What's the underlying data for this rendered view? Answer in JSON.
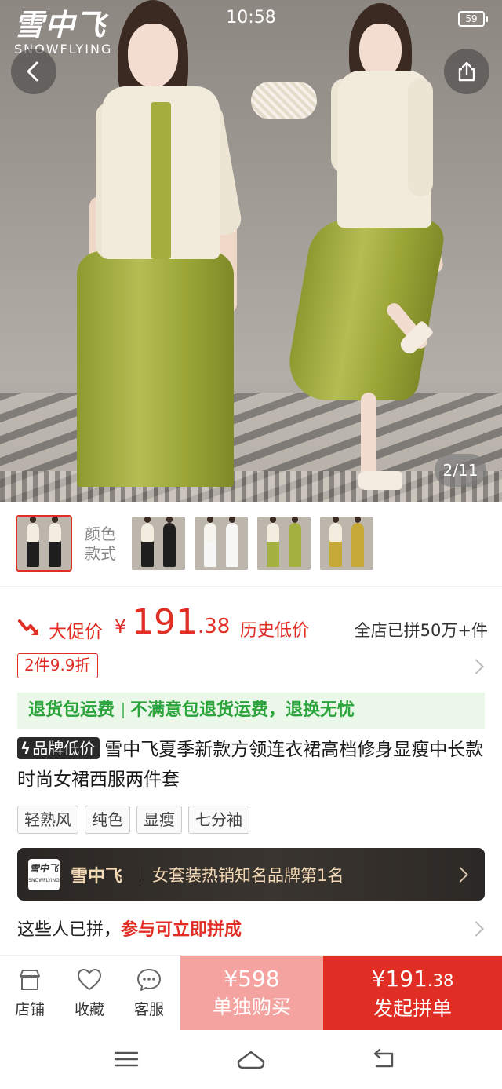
{
  "status_bar": {
    "time": "10:58",
    "battery": "59"
  },
  "hero": {
    "brand_cn": "雪中飞",
    "brand_en": "SNOWFLYING",
    "counter": "2/11"
  },
  "thumbnails": {
    "label_line1": "颜色",
    "label_line2": "款式",
    "items": [
      {
        "jacket": "#f3ede0",
        "dress": "#1e1e1e",
        "selected": true
      },
      {
        "jacket": "#f3ede0",
        "dress": "#1e1e1e",
        "selected": false
      },
      {
        "jacket": "#f7f4ee",
        "dress": "#f7f7f5",
        "selected": false
      },
      {
        "jacket": "#f3ede0",
        "dress": "#a4b040",
        "selected": false
      },
      {
        "jacket": "#f3ede0",
        "dress": "#c7a93a",
        "selected": false
      }
    ]
  },
  "price": {
    "promo_label": "大促价",
    "currency": "¥",
    "integer": "191",
    "decimal": ".38",
    "history_tag": "历史低价",
    "sold": "全店已拼50万+件",
    "discount_badge": "2件9.9折"
  },
  "guarantee": {
    "part1": "退货包运费",
    "part2": "不满意包退货运费，退换无忧"
  },
  "title": {
    "badge": "品牌低价",
    "text": "雪中飞夏季新款方领连衣裙高档修身显瘦中长款时尚女裙西服两件套"
  },
  "tags": [
    "轻熟风",
    "纯色",
    "显瘦",
    "七分袖"
  ],
  "brand_bar": {
    "logo_cn": "雪中飞",
    "logo_en": "SNOWFLYING",
    "name": "雪中飞",
    "slogan": "女套装热销知名品牌第1名"
  },
  "group_buy": {
    "text": "这些人已拼，",
    "highlight": "参与可立即拼成"
  },
  "action_bar": {
    "store": "店铺",
    "favorite": "收藏",
    "service": "客服",
    "single_price": "¥598",
    "single_label": "单独购买",
    "group_price_int": "¥191",
    "group_price_dec": ".38",
    "group_label": "发起拼单"
  },
  "colors": {
    "accent": "#e02e24",
    "single_button": "#f5a3a0",
    "guarantee_bg": "#ebf7e8",
    "guarantee_text": "#2aa43b",
    "brand_bar_text": "#f3d8b5"
  }
}
